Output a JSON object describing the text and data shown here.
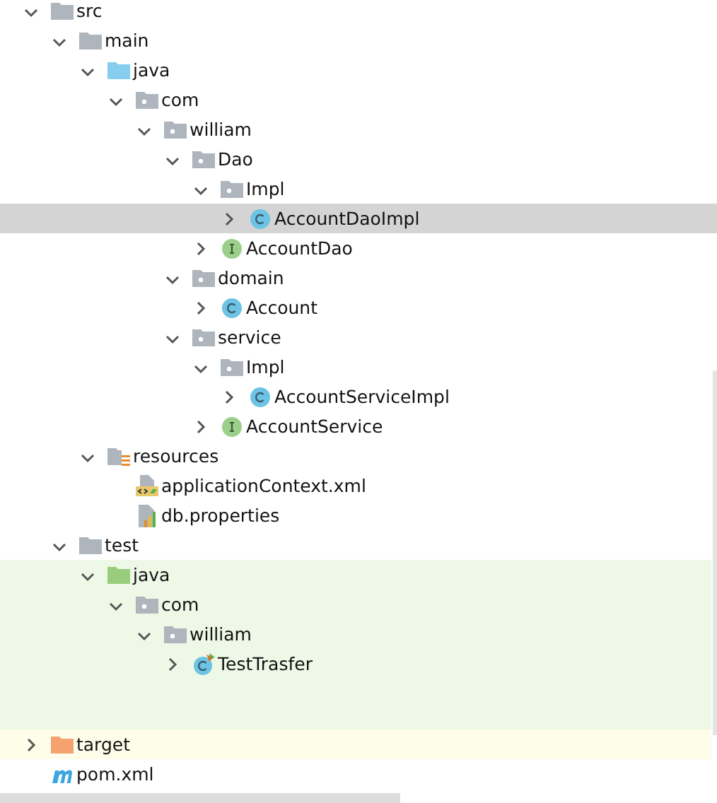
{
  "tree": [
    {
      "label": "src",
      "kind": "folder",
      "expanded": true,
      "selected": false,
      "children": [
        {
          "label": "main",
          "kind": "folder",
          "expanded": true,
          "selected": false,
          "children": [
            {
              "label": "java",
              "kind": "source-folder",
              "expanded": true,
              "selected": false,
              "children": [
                {
                  "label": "com",
                  "kind": "package",
                  "expanded": true,
                  "selected": false,
                  "children": [
                    {
                      "label": "william",
                      "kind": "package",
                      "expanded": true,
                      "selected": false,
                      "children": [
                        {
                          "label": "Dao",
                          "kind": "package",
                          "expanded": true,
                          "selected": false,
                          "children": [
                            {
                              "label": "Impl",
                              "kind": "package",
                              "expanded": true,
                              "selected": false,
                              "children": [
                                {
                                  "label": "AccountDaoImpl",
                                  "kind": "class",
                                  "expanded": false,
                                  "selected": true
                                }
                              ]
                            },
                            {
                              "label": "AccountDao",
                              "kind": "interface",
                              "expanded": false,
                              "selected": false
                            }
                          ]
                        },
                        {
                          "label": "domain",
                          "kind": "package",
                          "expanded": true,
                          "selected": false,
                          "children": [
                            {
                              "label": "Account",
                              "kind": "class",
                              "expanded": false,
                              "selected": false
                            }
                          ]
                        },
                        {
                          "label": "service",
                          "kind": "package",
                          "expanded": true,
                          "selected": false,
                          "children": [
                            {
                              "label": "Impl",
                              "kind": "package",
                              "expanded": true,
                              "selected": false,
                              "children": [
                                {
                                  "label": "AccountServiceImpl",
                                  "kind": "class",
                                  "expanded": false,
                                  "selected": false
                                }
                              ]
                            },
                            {
                              "label": "AccountService",
                              "kind": "interface",
                              "expanded": false,
                              "selected": false
                            }
                          ]
                        }
                      ]
                    }
                  ]
                }
              ]
            },
            {
              "label": "resources",
              "kind": "resources-folder",
              "expanded": true,
              "selected": false,
              "children": [
                {
                  "label": "applicationContext.xml",
                  "kind": "xml-file",
                  "selected": false
                },
                {
                  "label": "db.properties",
                  "kind": "properties-file",
                  "selected": false
                }
              ]
            }
          ]
        },
        {
          "label": "test",
          "kind": "folder",
          "expanded": true,
          "selected": false,
          "children": [
            {
              "label": "java",
              "kind": "test-folder",
              "expanded": true,
              "selected": false,
              "children": [
                {
                  "label": "com",
                  "kind": "package",
                  "expanded": true,
                  "selected": false,
                  "children": [
                    {
                      "label": "william",
                      "kind": "package",
                      "expanded": true,
                      "selected": false,
                      "children": [
                        {
                          "label": "TestTrasfer",
                          "kind": "test-class",
                          "expanded": false,
                          "selected": false
                        }
                      ]
                    }
                  ]
                }
              ]
            }
          ]
        }
      ]
    },
    {
      "label": "target",
      "kind": "excluded-folder",
      "expanded": false,
      "selected": false
    },
    {
      "label": "pom.xml",
      "kind": "maven-file",
      "selected": false
    }
  ]
}
